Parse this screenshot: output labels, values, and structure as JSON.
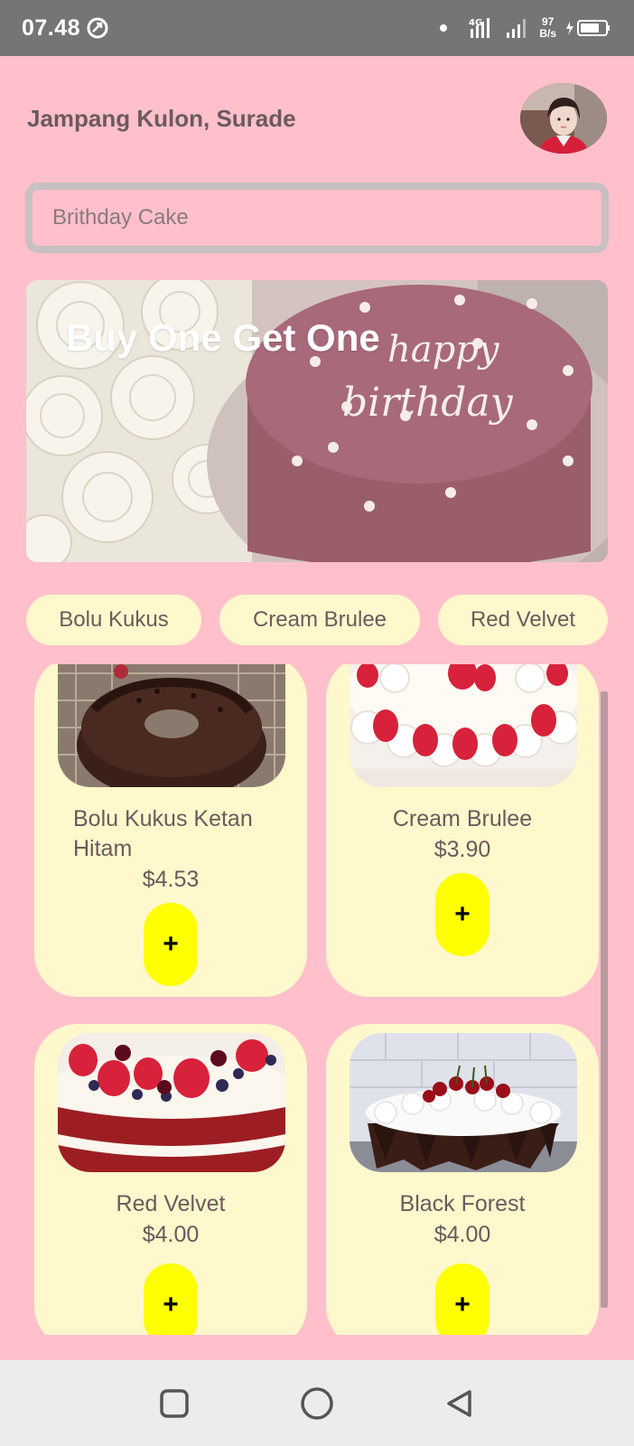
{
  "status_bar": {
    "time": "07.48",
    "network_type": "4G",
    "net_speed_value": "97",
    "net_speed_unit": "B/s"
  },
  "header": {
    "location": "Jampang Kulon, Surade",
    "avatar_icon": "user-avatar"
  },
  "search": {
    "placeholder": "Brithday Cake"
  },
  "banner": {
    "title": "Buy One Get One",
    "cake_text_line1": "happy",
    "cake_text_line2": "birthday"
  },
  "categories": [
    {
      "label": "Bolu Kukus"
    },
    {
      "label": "Cream Brulee"
    },
    {
      "label": "Red Velvet"
    }
  ],
  "products": [
    {
      "name": "Bolu Kukus Ketan Hitam",
      "price": "$4.53",
      "add_label": "+"
    },
    {
      "name": "Cream Brulee",
      "price": "$3.90",
      "add_label": "+"
    },
    {
      "name": "Red Velvet",
      "price": "$4.00",
      "add_label": "+"
    },
    {
      "name": "Black Forest",
      "price": "$4.00",
      "add_label": "+"
    }
  ],
  "nav": {
    "recents_icon": "square-icon",
    "home_icon": "circle-icon",
    "back_icon": "triangle-back-icon"
  },
  "colors": {
    "background": "#ffc0cb",
    "card": "#fff8cc",
    "add_button": "#ffff00",
    "status_bar": "#757575"
  }
}
